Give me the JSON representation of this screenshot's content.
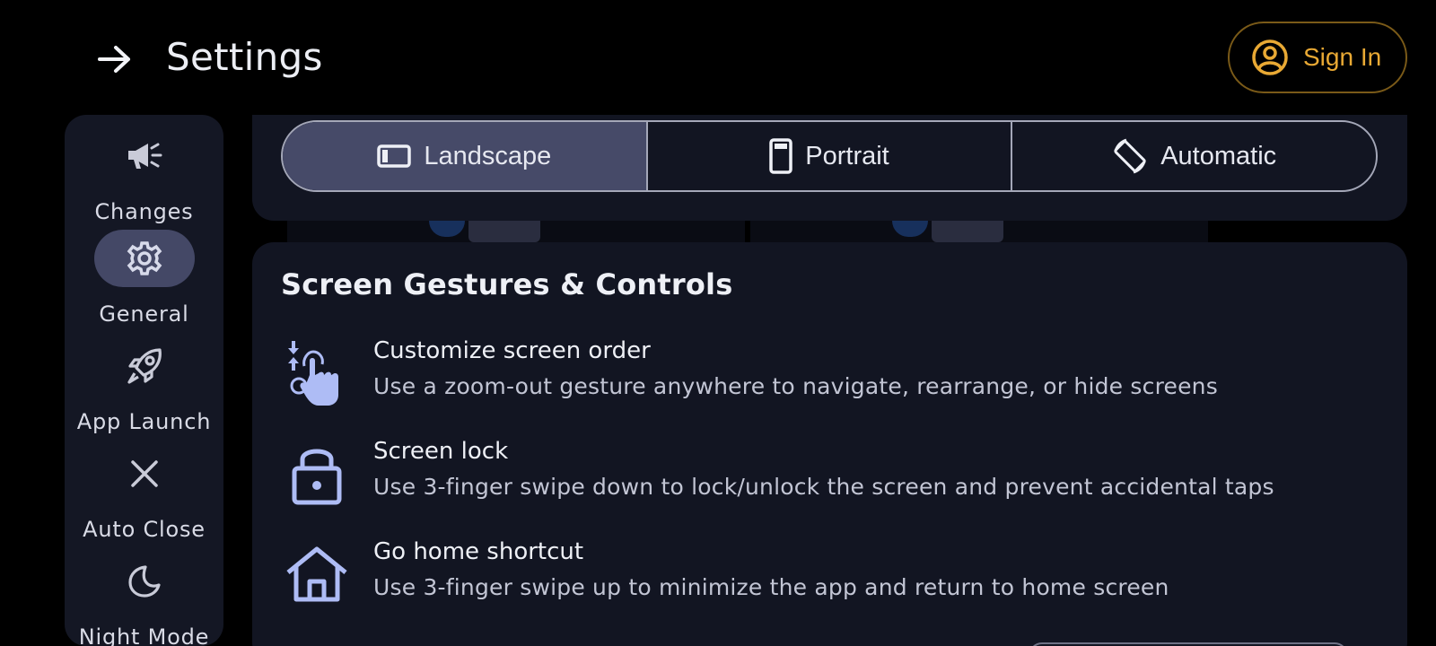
{
  "header": {
    "title": "Settings",
    "back_icon": "arrow-right-icon",
    "signin_label": "Sign In",
    "accent": "#e9a934"
  },
  "sidebar": {
    "items": [
      {
        "label": "Changes",
        "icon": "megaphone-icon"
      },
      {
        "label": "General",
        "icon": "gear-icon",
        "active": true
      },
      {
        "label": "App Launch",
        "icon": "rocket-icon"
      },
      {
        "label": "Auto Close",
        "icon": "close-icon"
      },
      {
        "label": "Night Mode",
        "icon": "moon-icon"
      }
    ]
  },
  "orientation": {
    "options": [
      {
        "label": "Landscape",
        "icon": "landscape-icon",
        "selected": true
      },
      {
        "label": "Portrait",
        "icon": "portrait-icon"
      },
      {
        "label": "Automatic",
        "icon": "auto-rotate-icon"
      }
    ]
  },
  "gestures": {
    "title": "Screen Gestures & Controls",
    "items": [
      {
        "name": "Customize screen order",
        "desc": "Use a zoom-out gesture anywhere to navigate, rearrange, or hide screens",
        "icon": "pinch-gesture-icon"
      },
      {
        "name": "Screen lock",
        "desc": "Use 3-finger swipe down to lock/unlock the screen and prevent accidental taps",
        "icon": "lock-icon"
      },
      {
        "name": "Go home shortcut",
        "desc": "Use 3-finger swipe up to minimize the app and return to home screen",
        "icon": "home-icon"
      }
    ]
  },
  "colors": {
    "background": "#000000",
    "card": "#121522",
    "selected": "#464a68",
    "icon_tint": "#aebcf5"
  }
}
